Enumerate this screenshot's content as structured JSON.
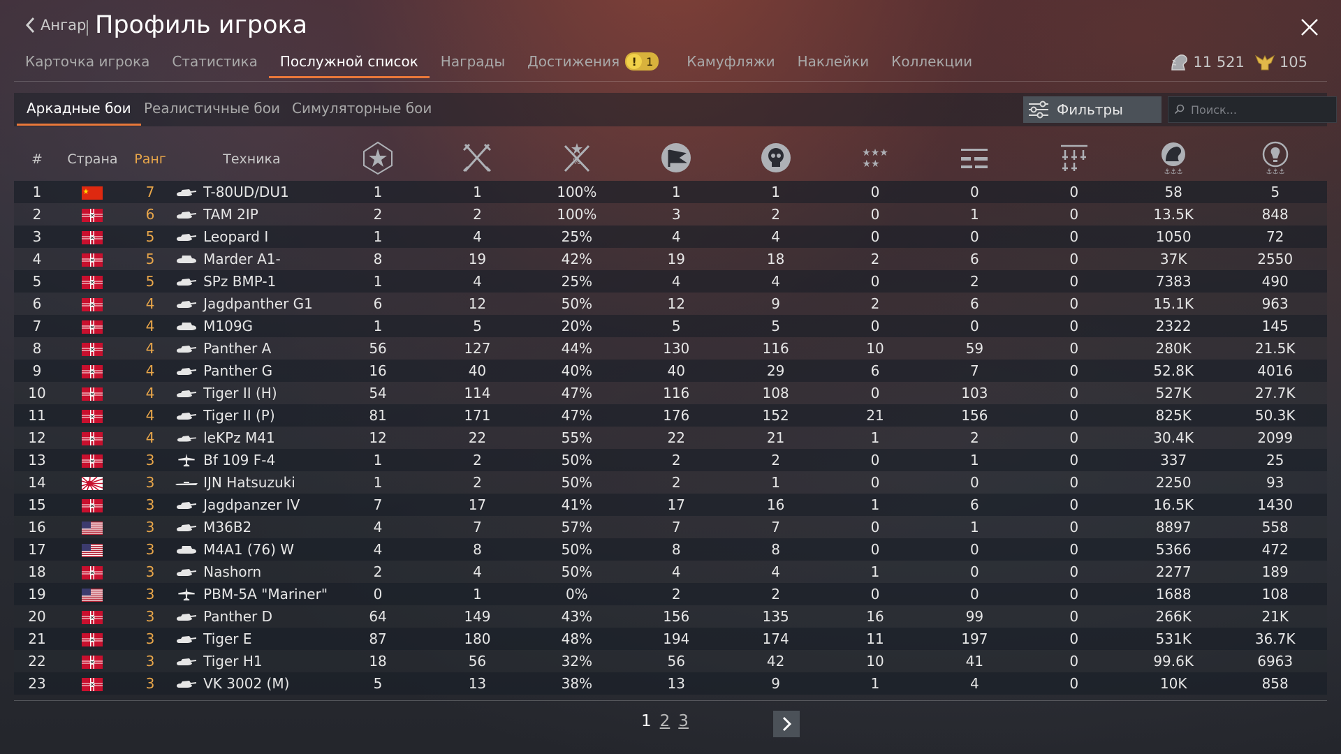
{
  "header": {
    "back_label": "Ангар",
    "title": "Профиль игрока"
  },
  "tabs": [
    {
      "label": "Карточка игрока"
    },
    {
      "label": "Статистика"
    },
    {
      "label": "Послужной список"
    },
    {
      "label": "Награды"
    },
    {
      "label": "Достижения",
      "badge": "1"
    },
    {
      "label": "Камуфляжи"
    },
    {
      "label": "Наклейки"
    },
    {
      "label": "Коллекции"
    }
  ],
  "active_tab": "Послужной список",
  "currency": {
    "silver": "11 521",
    "gold": "105"
  },
  "modes": [
    {
      "label": "Аркадные бои"
    },
    {
      "label": "Реалистичные бои"
    },
    {
      "label": "Симуляторные бои"
    }
  ],
  "active_mode": "Аркадные бои",
  "filters_label": "Фильтры",
  "search_placeholder": "Поиск...",
  "columns": {
    "num": "#",
    "country": "Страна",
    "rank": "Ранг",
    "vehicle": "Техника",
    "icons": [
      "battles-icon",
      "victories-icon",
      "win-rate-icon",
      "respawns-icon",
      "deaths-icon",
      "air-kills-icon",
      "ground-kills-icon",
      "naval-kills-icon",
      "lion-earned-icon",
      "research-points-icon"
    ]
  },
  "rows": [
    {
      "n": "1",
      "country": "china",
      "rank": "7",
      "type": "tank",
      "vehicle": "T-80UD/DU1",
      "stats": [
        "1",
        "1",
        "100%",
        "1",
        "1",
        "0",
        "0",
        "0",
        "58",
        "5"
      ]
    },
    {
      "n": "2",
      "country": "germany",
      "rank": "6",
      "type": "tank",
      "vehicle": "TAM 2IP",
      "stats": [
        "2",
        "2",
        "100%",
        "3",
        "2",
        "0",
        "1",
        "0",
        "13.5K",
        "848"
      ]
    },
    {
      "n": "3",
      "country": "germany",
      "rank": "5",
      "type": "tank",
      "vehicle": "Leopard I",
      "stats": [
        "1",
        "4",
        "25%",
        "4",
        "4",
        "0",
        "0",
        "0",
        "1050",
        "72"
      ]
    },
    {
      "n": "4",
      "country": "germany",
      "rank": "5",
      "type": "spg",
      "vehicle": "Marder A1-",
      "stats": [
        "8",
        "19",
        "42%",
        "19",
        "18",
        "2",
        "6",
        "0",
        "37K",
        "2550"
      ]
    },
    {
      "n": "5",
      "country": "germany",
      "rank": "5",
      "type": "tank",
      "vehicle": "SPz BMP-1",
      "stats": [
        "1",
        "4",
        "25%",
        "4",
        "4",
        "0",
        "2",
        "0",
        "7383",
        "490"
      ]
    },
    {
      "n": "6",
      "country": "germany",
      "rank": "4",
      "type": "tank",
      "vehicle": "Jagdpanther G1",
      "stats": [
        "6",
        "12",
        "50%",
        "12",
        "9",
        "2",
        "6",
        "0",
        "15.1K",
        "963"
      ]
    },
    {
      "n": "7",
      "country": "germany",
      "rank": "4",
      "type": "spg",
      "vehicle": "M109G",
      "stats": [
        "1",
        "5",
        "20%",
        "5",
        "5",
        "0",
        "0",
        "0",
        "2322",
        "145"
      ]
    },
    {
      "n": "8",
      "country": "germany",
      "rank": "4",
      "type": "tank",
      "vehicle": "Panther A",
      "stats": [
        "56",
        "127",
        "44%",
        "130",
        "116",
        "10",
        "59",
        "0",
        "280K",
        "21.5K"
      ]
    },
    {
      "n": "9",
      "country": "germany",
      "rank": "4",
      "type": "tank",
      "vehicle": "Panther G",
      "stats": [
        "16",
        "40",
        "40%",
        "40",
        "29",
        "6",
        "7",
        "0",
        "52.8K",
        "4016"
      ]
    },
    {
      "n": "10",
      "country": "germany",
      "rank": "4",
      "type": "tank",
      "vehicle": "Tiger II (H)",
      "stats": [
        "54",
        "114",
        "47%",
        "116",
        "108",
        "0",
        "103",
        "0",
        "527K",
        "27.7K"
      ]
    },
    {
      "n": "11",
      "country": "germany",
      "rank": "4",
      "type": "tank",
      "vehicle": "Tiger II (P)",
      "stats": [
        "81",
        "171",
        "47%",
        "176",
        "152",
        "21",
        "156",
        "0",
        "825K",
        "50.3K"
      ]
    },
    {
      "n": "12",
      "country": "germany",
      "rank": "4",
      "type": "light",
      "vehicle": "leKPz M41",
      "stats": [
        "12",
        "22",
        "55%",
        "22",
        "21",
        "1",
        "2",
        "0",
        "30.4K",
        "2099"
      ]
    },
    {
      "n": "13",
      "country": "germany",
      "rank": "3",
      "type": "plane",
      "vehicle": "Bf 109 F-4",
      "stats": [
        "1",
        "2",
        "50%",
        "2",
        "2",
        "0",
        "1",
        "0",
        "337",
        "25"
      ]
    },
    {
      "n": "14",
      "country": "japan",
      "rank": "3",
      "type": "ship",
      "vehicle": "IJN Hatsuzuki",
      "stats": [
        "1",
        "2",
        "50%",
        "2",
        "1",
        "0",
        "0",
        "0",
        "2250",
        "93"
      ]
    },
    {
      "n": "15",
      "country": "germany",
      "rank": "3",
      "type": "tank",
      "vehicle": "Jagdpanzer IV",
      "stats": [
        "7",
        "17",
        "41%",
        "17",
        "16",
        "1",
        "6",
        "0",
        "16.5K",
        "1430"
      ]
    },
    {
      "n": "16",
      "country": "usa",
      "rank": "3",
      "type": "tank",
      "vehicle": "M36B2",
      "stats": [
        "4",
        "7",
        "57%",
        "7",
        "7",
        "0",
        "1",
        "0",
        "8897",
        "558"
      ]
    },
    {
      "n": "17",
      "country": "usa",
      "rank": "3",
      "type": "spg",
      "vehicle": "M4A1 (76) W",
      "stats": [
        "4",
        "8",
        "50%",
        "8",
        "8",
        "0",
        "0",
        "0",
        "5366",
        "472"
      ]
    },
    {
      "n": "18",
      "country": "germany",
      "rank": "3",
      "type": "tank",
      "vehicle": "Nashorn",
      "stats": [
        "2",
        "4",
        "50%",
        "4",
        "4",
        "1",
        "0",
        "0",
        "2277",
        "189"
      ]
    },
    {
      "n": "19",
      "country": "usa",
      "rank": "3",
      "type": "plane",
      "vehicle": "PBM-5A \"Mariner\"",
      "stats": [
        "0",
        "1",
        "0%",
        "2",
        "2",
        "0",
        "0",
        "0",
        "1688",
        "108"
      ]
    },
    {
      "n": "20",
      "country": "germany",
      "rank": "3",
      "type": "tank",
      "vehicle": "Panther D",
      "stats": [
        "64",
        "149",
        "43%",
        "156",
        "135",
        "16",
        "99",
        "0",
        "266K",
        "21K"
      ]
    },
    {
      "n": "21",
      "country": "germany",
      "rank": "3",
      "type": "tank",
      "vehicle": "Tiger E",
      "stats": [
        "87",
        "180",
        "48%",
        "194",
        "174",
        "11",
        "197",
        "0",
        "531K",
        "36.7K"
      ]
    },
    {
      "n": "22",
      "country": "germany",
      "rank": "3",
      "type": "tank",
      "vehicle": "Tiger H1",
      "stats": [
        "18",
        "56",
        "32%",
        "56",
        "42",
        "10",
        "41",
        "0",
        "99.6K",
        "6963"
      ]
    },
    {
      "n": "23",
      "country": "germany",
      "rank": "3",
      "type": "tank",
      "vehicle": "VK 3002 (M)",
      "stats": [
        "5",
        "13",
        "38%",
        "13",
        "9",
        "1",
        "4",
        "0",
        "10K",
        "858"
      ]
    }
  ],
  "pagination": {
    "pages": [
      "1",
      "2",
      "3"
    ],
    "current": "1"
  },
  "colors": {
    "accent": "#e9783a",
    "rank": "#e8a64a",
    "badge": "#d8b23c"
  }
}
